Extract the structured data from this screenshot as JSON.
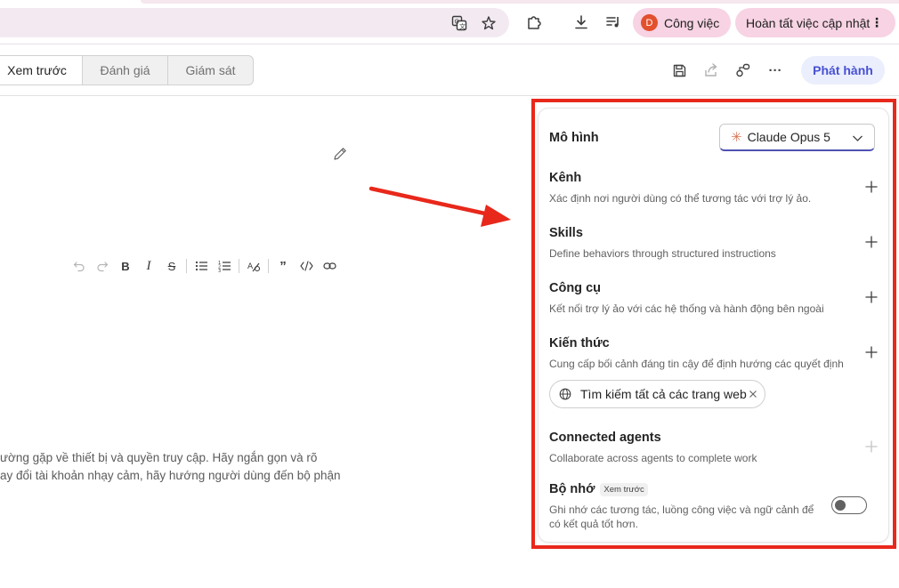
{
  "browser": {
    "profile": {
      "initial": "D",
      "label": "Công việc"
    },
    "update_label": "Hoàn tất việc cập nhật",
    "more_glyph": "⋮",
    "icons": [
      "translate-icon",
      "star-icon",
      "extensions-icon",
      "download-icon",
      "media-control-icon"
    ]
  },
  "toolbar": {
    "tabs": [
      "Xem trước",
      "Đánh giá",
      "Giám sát"
    ],
    "active_tab": "Xem trước",
    "publish_label": "Phát hành",
    "more_glyph": "···"
  },
  "editor": {
    "body_lines": [
      "ường gặp về thiết bị và quyền truy cập. Hãy ngắn gọn và rõ",
      "ay đổi tài khoản nhạy cảm, hãy hướng người dùng đến bộ phận"
    ]
  },
  "panel": {
    "model": {
      "label": "Mô hình",
      "value": "Claude Opus 5"
    },
    "sections": {
      "channels": {
        "title": "Kênh",
        "desc": "Xác định nơi người dùng có thể tương tác với trợ lý ảo."
      },
      "skills": {
        "title": "Skills",
        "desc": "Define behaviors through structured instructions"
      },
      "tools": {
        "title": "Công cụ",
        "desc": "Kết nối trợ lý ảo với các hệ thống và hành động bên ngoài"
      },
      "knowledge": {
        "title": "Kiến thức",
        "desc": "Cung cấp bối cảnh đáng tin cậy để định hướng các quyết định",
        "chip": "Tìm kiếm tất cả các trang web"
      },
      "agents": {
        "title": "Connected agents",
        "desc": "Collaborate across agents to complete work"
      },
      "memory": {
        "title": "Bộ nhớ",
        "badge": "Xem trước",
        "desc": "Ghi nhớ các tương tác, luồng công việc và ngữ cảnh để có kết quả tốt hơn.",
        "enabled": false
      }
    }
  },
  "colors": {
    "accent": "#4750d4",
    "highlight_frame": "#e8281b",
    "profile_chip": "#f7d3e3"
  }
}
